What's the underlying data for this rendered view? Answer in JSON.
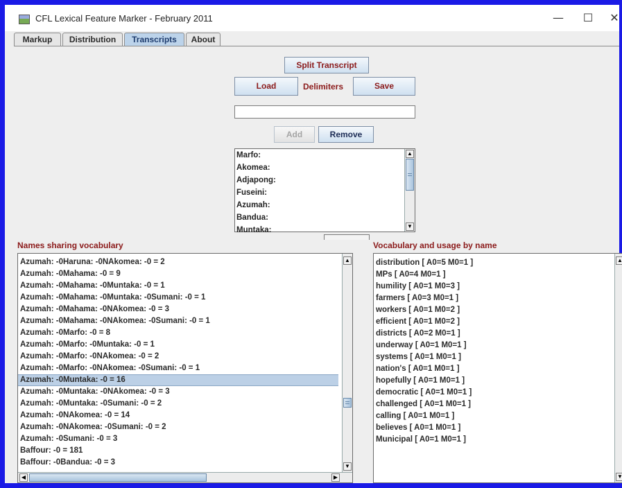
{
  "window": {
    "title": "CFL Lexical Feature Marker - February 2011",
    "minimize_glyph": "—",
    "maximize_glyph": "☐",
    "close_glyph": "✕"
  },
  "tabs": [
    {
      "label": "Markup",
      "active": false
    },
    {
      "label": "Distribution",
      "active": false
    },
    {
      "label": "Transcripts",
      "active": true
    },
    {
      "label": "About",
      "active": false
    }
  ],
  "controls": {
    "split_transcript": "Split Transcript",
    "load": "Load",
    "delimiters": "Delimiters",
    "save": "Save",
    "delimiter_input_value": "",
    "add": "Add",
    "remove": "Remove"
  },
  "speaker_names": [
    "Marfo:",
    "Akomea:",
    "Adjapong:",
    "Fuseini:",
    "Azumah:",
    "Bandua:",
    "Muntaka:"
  ],
  "names_sharing": {
    "title": "Names sharing vocabulary",
    "selected_row": "Azumah: -0Muntaka: -0 = 16",
    "rows": [
      "Azumah: -0Haruna: -0NAkomea: -0 = 2",
      "Azumah: -0Mahama: -0 = 9",
      "Azumah: -0Mahama: -0Muntaka: -0 = 1",
      "Azumah: -0Mahama: -0Muntaka: -0Sumani: -0 = 1",
      "Azumah: -0Mahama: -0NAkomea: -0 = 3",
      "Azumah: -0Mahama: -0NAkomea: -0Sumani: -0 = 1",
      "Azumah: -0Marfo: -0 = 8",
      "Azumah: -0Marfo: -0Muntaka: -0 = 1",
      "Azumah: -0Marfo: -0NAkomea: -0 = 2",
      "Azumah: -0Marfo: -0NAkomea: -0Sumani: -0 = 1",
      "Azumah: -0Muntaka: -0 = 16",
      "Azumah: -0Muntaka: -0NAkomea: -0 = 3",
      "Azumah: -0Muntaka: -0Sumani: -0 = 2",
      "Azumah: -0NAkomea: -0 = 14",
      "Azumah: -0NAkomea: -0Sumani: -0 = 2",
      "Azumah: -0Sumani: -0 = 3",
      "Baffour: -0 = 181",
      "Baffour: -0Bandua: -0 = 3"
    ]
  },
  "vocabulary": {
    "title": "Vocabulary and usage by name",
    "rows": [
      "distribution [ A0=5  M0=1 ]",
      "MPs [ A0=4  M0=1 ]",
      "humility [ A0=1  M0=3 ]",
      "farmers [ A0=3  M0=1 ]",
      "workers [ A0=1  M0=2 ]",
      "efficient [ A0=1  M0=2 ]",
      "districts [ A0=2  M0=1 ]",
      "underway [ A0=1  M0=1 ]",
      "systems [ A0=1  M0=1 ]",
      "nation's [ A0=1  M0=1 ]",
      "hopefully [ A0=1  M0=1 ]",
      "democratic [ A0=1  M0=1 ]",
      "challenged [ A0=1  M0=1 ]",
      "calling [ A0=1  M0=1 ]",
      "believes [ A0=1  M0=1 ]",
      "Municipal [ A0=1  M0=1 ]"
    ]
  },
  "scroll": {
    "up_glyph": "▲",
    "down_glyph": "▼",
    "left_glyph": "◀",
    "right_glyph": "▶"
  }
}
